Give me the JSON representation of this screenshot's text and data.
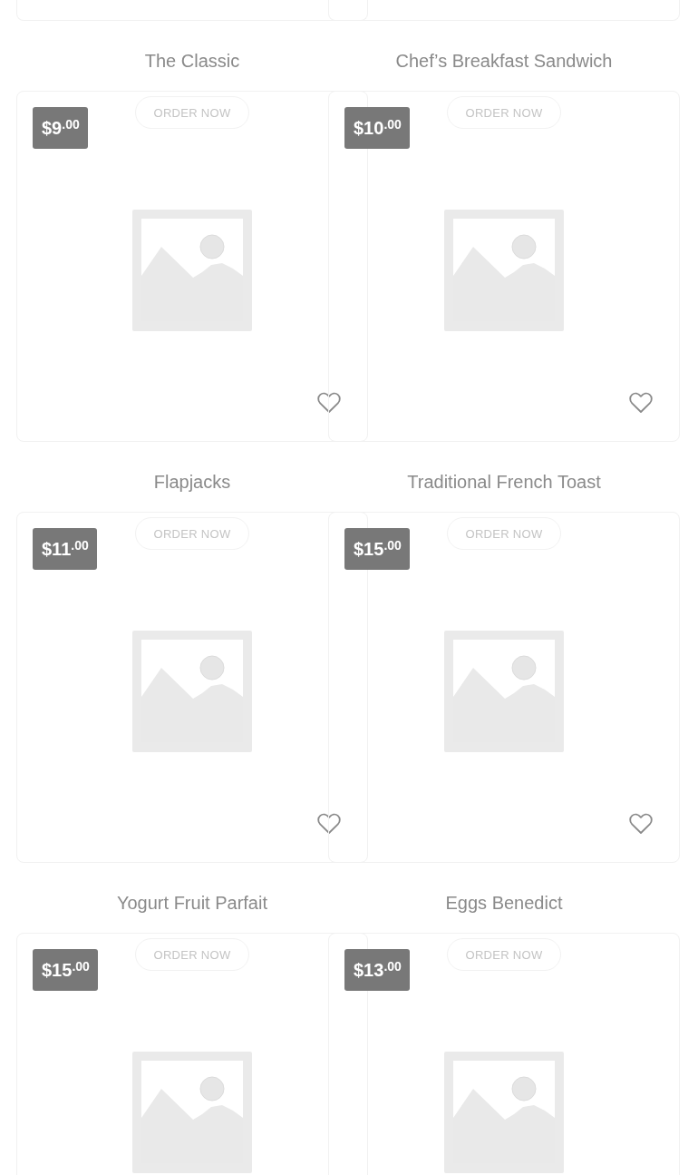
{
  "products": [
    {
      "title": "The Classic",
      "price": "$9$^{.00}$",
      "button": "ORDER NOW"
    },
    {
      "title": "Chef’s Breakfast Sandwich",
      "price": "$10$^{.00}$",
      "button": "ORDER NOW"
    },
    {
      "title": "Flapjacks",
      "price": "$11$^{.00}$",
      "button": "ORDER NOW"
    },
    {
      "title": "Traditional French Toast",
      "price": "$15$^{.00}$",
      "button": "ORDER NOW"
    },
    {
      "title": "Yogurt Fruit Parfait",
      "price": "$15$^{.00}$",
      "button": "ORDER NOW"
    },
    {
      "title": "Eggs Benedict",
      "price": "$13$^{.00}$",
      "button": "ORDER NOW"
    }
  ]
}
